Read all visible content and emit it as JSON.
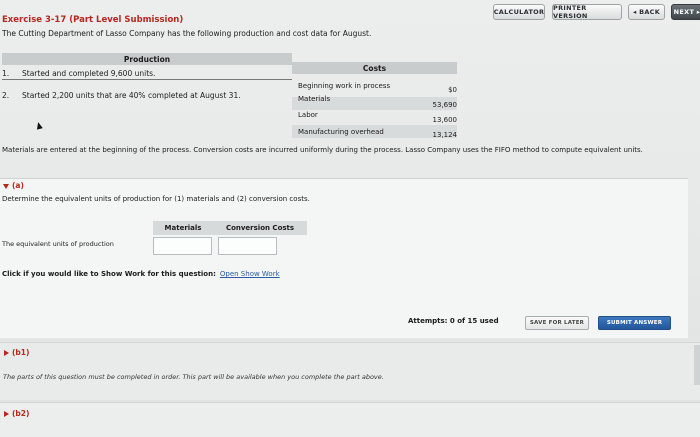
{
  "toolbar": {
    "calculator": "CALCULATOR",
    "printer_version": "PRINTER VERSION",
    "back": "◂ BACK",
    "next": "NEXT ▸"
  },
  "exercise": {
    "title": "Exercise 3-17 (Part Level Submission)",
    "intro": "The Cutting Department of Lasso Company has the following production and cost data for August."
  },
  "production": {
    "heading": "Production",
    "items": [
      {
        "num": "1.",
        "text": "Started and completed 9,600 units."
      },
      {
        "num": "2.",
        "text": "Started 2,200 units that are 40% completed at August 31."
      }
    ]
  },
  "costs": {
    "heading": "Costs",
    "rows": [
      {
        "label": "Beginning work in process",
        "value": "$0"
      },
      {
        "label": "Materials",
        "value": "53,690"
      },
      {
        "label": "Labor",
        "value": "13,600"
      },
      {
        "label": "Manufacturing overhead",
        "value": "13,124"
      }
    ]
  },
  "note": "Materials are entered at the beginning of the process. Conversion costs are incurred uniformly during the process. Lasso Company uses the FIFO method to compute equivalent units.",
  "part_a": {
    "label": "(a)",
    "question": "Determine the equivalent units of production for (1) materials and (2) conversion costs.",
    "col_materials": "Materials",
    "col_conversion": "Conversion Costs",
    "row_label": "The equivalent units of production",
    "materials_value": "",
    "conversion_value": "",
    "show_work_prompt": "Click if you would like to Show Work for this question:",
    "show_work_link": "Open Show Work",
    "attempts": "Attempts: 0 of 15 used",
    "save_later": "SAVE FOR LATER",
    "submit": "SUBMIT ANSWER"
  },
  "part_b1": {
    "label": "(b1)",
    "note": "The parts of this question must be completed in order. This part will be available when you complete the part above."
  },
  "part_b2": {
    "label": "(b2)"
  }
}
